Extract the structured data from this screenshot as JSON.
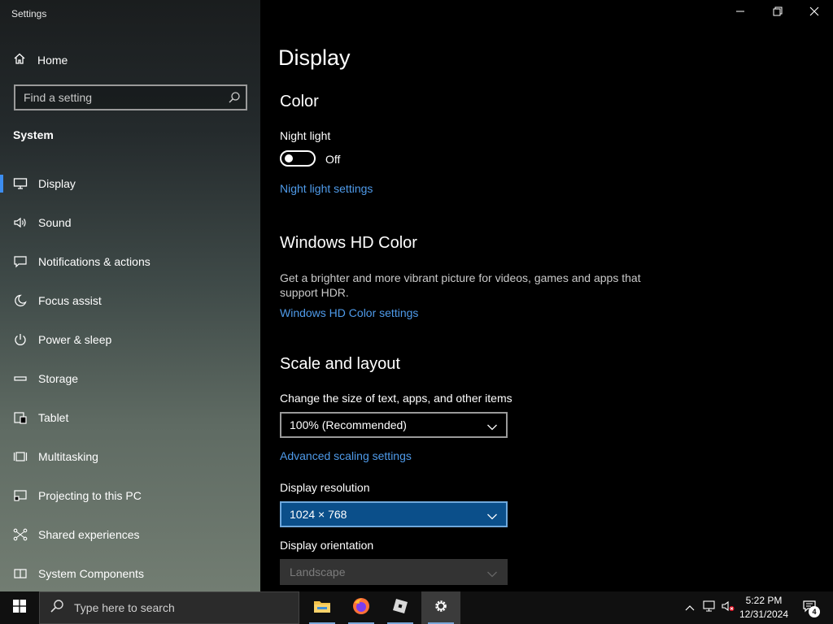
{
  "window": {
    "title": "Settings"
  },
  "sidebar": {
    "home_label": "Home",
    "search_placeholder": "Find a setting",
    "section_label": "System",
    "items": [
      {
        "label": "Display",
        "icon": "monitor-icon",
        "active": true
      },
      {
        "label": "Sound",
        "icon": "speaker-icon"
      },
      {
        "label": "Notifications & actions",
        "icon": "notification-icon"
      },
      {
        "label": "Focus assist",
        "icon": "moon-icon"
      },
      {
        "label": "Power & sleep",
        "icon": "power-icon"
      },
      {
        "label": "Storage",
        "icon": "storage-icon"
      },
      {
        "label": "Tablet",
        "icon": "tablet-icon"
      },
      {
        "label": "Multitasking",
        "icon": "multitasking-icon"
      },
      {
        "label": "Projecting to this PC",
        "icon": "projecting-icon"
      },
      {
        "label": "Shared experiences",
        "icon": "shared-icon"
      },
      {
        "label": "System Components",
        "icon": "components-icon"
      }
    ]
  },
  "main": {
    "page_title": "Display",
    "color": {
      "heading": "Color",
      "night_light_label": "Night light",
      "night_light_state": "Off",
      "night_light_link": "Night light settings"
    },
    "hd_color": {
      "heading": "Windows HD Color",
      "description": "Get a brighter and more vibrant picture for videos, games and apps that support HDR.",
      "link": "Windows HD Color settings"
    },
    "scale": {
      "heading": "Scale and layout",
      "size_label": "Change the size of text, apps, and other items",
      "size_value": "100% (Recommended)",
      "advanced_link": "Advanced scaling settings",
      "resolution_label": "Display resolution",
      "resolution_value": "1024 × 768",
      "orientation_label": "Display orientation",
      "orientation_value": "Landscape"
    }
  },
  "taskbar": {
    "search_placeholder": "Type here to search",
    "apps": [
      "file-explorer-icon",
      "firefox-icon",
      "roblox-icon",
      "settings-gear-icon"
    ],
    "time": "5:22 PM",
    "date": "12/31/2024",
    "notification_count": "4"
  },
  "colors": {
    "accent": "#3c8df0",
    "link": "#4f9bea",
    "selected_dropdown": "#0b4f8a",
    "disabled_dropdown": "#333333"
  }
}
